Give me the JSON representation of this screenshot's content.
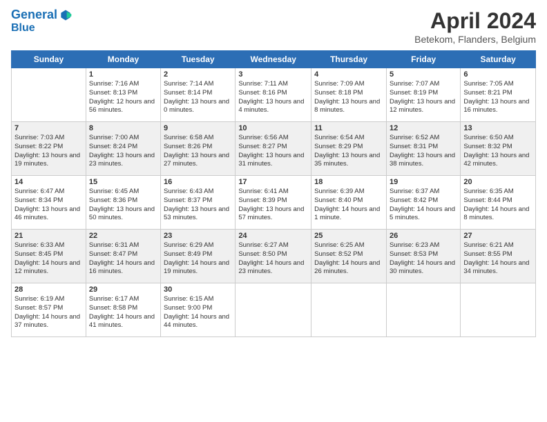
{
  "header": {
    "logo_line1": "General",
    "logo_line2": "Blue",
    "title": "April 2024",
    "location": "Betekom, Flanders, Belgium"
  },
  "columns": [
    "Sunday",
    "Monday",
    "Tuesday",
    "Wednesday",
    "Thursday",
    "Friday",
    "Saturday"
  ],
  "weeks": [
    [
      {
        "day": "",
        "sunrise": "",
        "sunset": "",
        "daylight": ""
      },
      {
        "day": "1",
        "sunrise": "Sunrise: 7:16 AM",
        "sunset": "Sunset: 8:13 PM",
        "daylight": "Daylight: 12 hours and 56 minutes."
      },
      {
        "day": "2",
        "sunrise": "Sunrise: 7:14 AM",
        "sunset": "Sunset: 8:14 PM",
        "daylight": "Daylight: 13 hours and 0 minutes."
      },
      {
        "day": "3",
        "sunrise": "Sunrise: 7:11 AM",
        "sunset": "Sunset: 8:16 PM",
        "daylight": "Daylight: 13 hours and 4 minutes."
      },
      {
        "day": "4",
        "sunrise": "Sunrise: 7:09 AM",
        "sunset": "Sunset: 8:18 PM",
        "daylight": "Daylight: 13 hours and 8 minutes."
      },
      {
        "day": "5",
        "sunrise": "Sunrise: 7:07 AM",
        "sunset": "Sunset: 8:19 PM",
        "daylight": "Daylight: 13 hours and 12 minutes."
      },
      {
        "day": "6",
        "sunrise": "Sunrise: 7:05 AM",
        "sunset": "Sunset: 8:21 PM",
        "daylight": "Daylight: 13 hours and 16 minutes."
      }
    ],
    [
      {
        "day": "7",
        "sunrise": "Sunrise: 7:03 AM",
        "sunset": "Sunset: 8:22 PM",
        "daylight": "Daylight: 13 hours and 19 minutes."
      },
      {
        "day": "8",
        "sunrise": "Sunrise: 7:00 AM",
        "sunset": "Sunset: 8:24 PM",
        "daylight": "Daylight: 13 hours and 23 minutes."
      },
      {
        "day": "9",
        "sunrise": "Sunrise: 6:58 AM",
        "sunset": "Sunset: 8:26 PM",
        "daylight": "Daylight: 13 hours and 27 minutes."
      },
      {
        "day": "10",
        "sunrise": "Sunrise: 6:56 AM",
        "sunset": "Sunset: 8:27 PM",
        "daylight": "Daylight: 13 hours and 31 minutes."
      },
      {
        "day": "11",
        "sunrise": "Sunrise: 6:54 AM",
        "sunset": "Sunset: 8:29 PM",
        "daylight": "Daylight: 13 hours and 35 minutes."
      },
      {
        "day": "12",
        "sunrise": "Sunrise: 6:52 AM",
        "sunset": "Sunset: 8:31 PM",
        "daylight": "Daylight: 13 hours and 38 minutes."
      },
      {
        "day": "13",
        "sunrise": "Sunrise: 6:50 AM",
        "sunset": "Sunset: 8:32 PM",
        "daylight": "Daylight: 13 hours and 42 minutes."
      }
    ],
    [
      {
        "day": "14",
        "sunrise": "Sunrise: 6:47 AM",
        "sunset": "Sunset: 8:34 PM",
        "daylight": "Daylight: 13 hours and 46 minutes."
      },
      {
        "day": "15",
        "sunrise": "Sunrise: 6:45 AM",
        "sunset": "Sunset: 8:36 PM",
        "daylight": "Daylight: 13 hours and 50 minutes."
      },
      {
        "day": "16",
        "sunrise": "Sunrise: 6:43 AM",
        "sunset": "Sunset: 8:37 PM",
        "daylight": "Daylight: 13 hours and 53 minutes."
      },
      {
        "day": "17",
        "sunrise": "Sunrise: 6:41 AM",
        "sunset": "Sunset: 8:39 PM",
        "daylight": "Daylight: 13 hours and 57 minutes."
      },
      {
        "day": "18",
        "sunrise": "Sunrise: 6:39 AM",
        "sunset": "Sunset: 8:40 PM",
        "daylight": "Daylight: 14 hours and 1 minute."
      },
      {
        "day": "19",
        "sunrise": "Sunrise: 6:37 AM",
        "sunset": "Sunset: 8:42 PM",
        "daylight": "Daylight: 14 hours and 5 minutes."
      },
      {
        "day": "20",
        "sunrise": "Sunrise: 6:35 AM",
        "sunset": "Sunset: 8:44 PM",
        "daylight": "Daylight: 14 hours and 8 minutes."
      }
    ],
    [
      {
        "day": "21",
        "sunrise": "Sunrise: 6:33 AM",
        "sunset": "Sunset: 8:45 PM",
        "daylight": "Daylight: 14 hours and 12 minutes."
      },
      {
        "day": "22",
        "sunrise": "Sunrise: 6:31 AM",
        "sunset": "Sunset: 8:47 PM",
        "daylight": "Daylight: 14 hours and 16 minutes."
      },
      {
        "day": "23",
        "sunrise": "Sunrise: 6:29 AM",
        "sunset": "Sunset: 8:49 PM",
        "daylight": "Daylight: 14 hours and 19 minutes."
      },
      {
        "day": "24",
        "sunrise": "Sunrise: 6:27 AM",
        "sunset": "Sunset: 8:50 PM",
        "daylight": "Daylight: 14 hours and 23 minutes."
      },
      {
        "day": "25",
        "sunrise": "Sunrise: 6:25 AM",
        "sunset": "Sunset: 8:52 PM",
        "daylight": "Daylight: 14 hours and 26 minutes."
      },
      {
        "day": "26",
        "sunrise": "Sunrise: 6:23 AM",
        "sunset": "Sunset: 8:53 PM",
        "daylight": "Daylight: 14 hours and 30 minutes."
      },
      {
        "day": "27",
        "sunrise": "Sunrise: 6:21 AM",
        "sunset": "Sunset: 8:55 PM",
        "daylight": "Daylight: 14 hours and 34 minutes."
      }
    ],
    [
      {
        "day": "28",
        "sunrise": "Sunrise: 6:19 AM",
        "sunset": "Sunset: 8:57 PM",
        "daylight": "Daylight: 14 hours and 37 minutes."
      },
      {
        "day": "29",
        "sunrise": "Sunrise: 6:17 AM",
        "sunset": "Sunset: 8:58 PM",
        "daylight": "Daylight: 14 hours and 41 minutes."
      },
      {
        "day": "30",
        "sunrise": "Sunrise: 6:15 AM",
        "sunset": "Sunset: 9:00 PM",
        "daylight": "Daylight: 14 hours and 44 minutes."
      },
      {
        "day": "",
        "sunrise": "",
        "sunset": "",
        "daylight": ""
      },
      {
        "day": "",
        "sunrise": "",
        "sunset": "",
        "daylight": ""
      },
      {
        "day": "",
        "sunrise": "",
        "sunset": "",
        "daylight": ""
      },
      {
        "day": "",
        "sunrise": "",
        "sunset": "",
        "daylight": ""
      }
    ]
  ]
}
